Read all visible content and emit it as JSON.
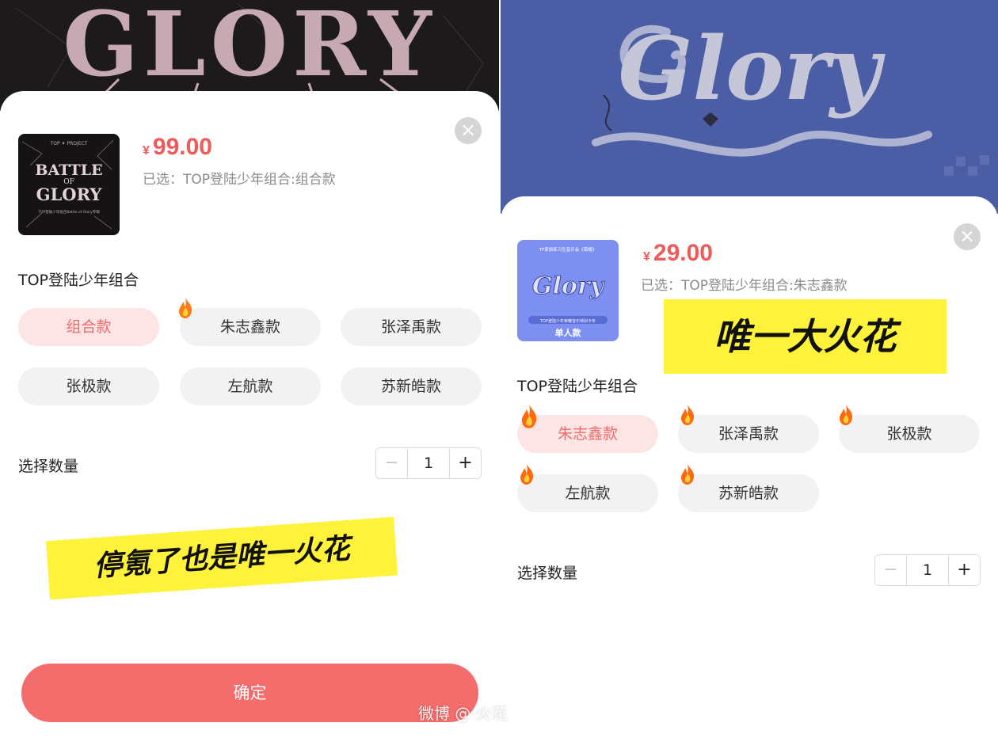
{
  "left": {
    "banner_text": "GLORY",
    "thumb": {
      "title": "BATTLE OF GLORY",
      "top_text": "TOP ✦ PROJECT",
      "caption": "TOP登陆少年组合Battle of Glory专辑"
    },
    "price": {
      "currency": "¥",
      "amount": "99.00"
    },
    "selected_text": "已选：TOP登陆少年组合:组合款",
    "group_label": "TOP登陆少年组合",
    "options": [
      {
        "label": "组合款",
        "selected": true,
        "fire": false
      },
      {
        "label": "朱志鑫款",
        "selected": false,
        "fire": true
      },
      {
        "label": "张泽禹款",
        "selected": false,
        "fire": false
      },
      {
        "label": "张极款",
        "selected": false,
        "fire": false
      },
      {
        "label": "左航款",
        "selected": false,
        "fire": false
      },
      {
        "label": "苏新皓款",
        "selected": false,
        "fire": false
      }
    ],
    "qty_label": "选择数量",
    "stepper": {
      "minus": "−",
      "value": "1",
      "plus": "+"
    },
    "sticker": "停氪了也是唯一火花",
    "confirm_label": "确定",
    "close": "×"
  },
  "right": {
    "banner_text": "Glory",
    "thumb": {
      "title": "Glory",
      "top_text": "TF家族练习生音乐会《荣耀》",
      "caption": "TOP登陆少年荣耀音乐特别卡专",
      "badge": "单人款"
    },
    "price": {
      "currency": "¥",
      "amount": "29.00"
    },
    "selected_text": "已选：TOP登陆少年组合:朱志鑫款",
    "group_label": "TOP登陆少年组合",
    "options": [
      {
        "label": "朱志鑫款",
        "selected": true,
        "fire": true
      },
      {
        "label": "张泽禹款",
        "selected": false,
        "fire": true
      },
      {
        "label": "张极款",
        "selected": false,
        "fire": true
      },
      {
        "label": "左航款",
        "selected": false,
        "fire": true
      },
      {
        "label": "苏新皓款",
        "selected": false,
        "fire": true
      }
    ],
    "qty_label": "选择数量",
    "stepper": {
      "minus": "−",
      "value": "1",
      "plus": "+"
    },
    "sticker": "唯一大火花",
    "close": "×"
  },
  "watermark": "微博 @·火花",
  "colors": {
    "accent": "#ef5a5a",
    "confirm": "#f46d6d",
    "selected_bg": "#fde5e5",
    "sticker": "#fff23a"
  }
}
